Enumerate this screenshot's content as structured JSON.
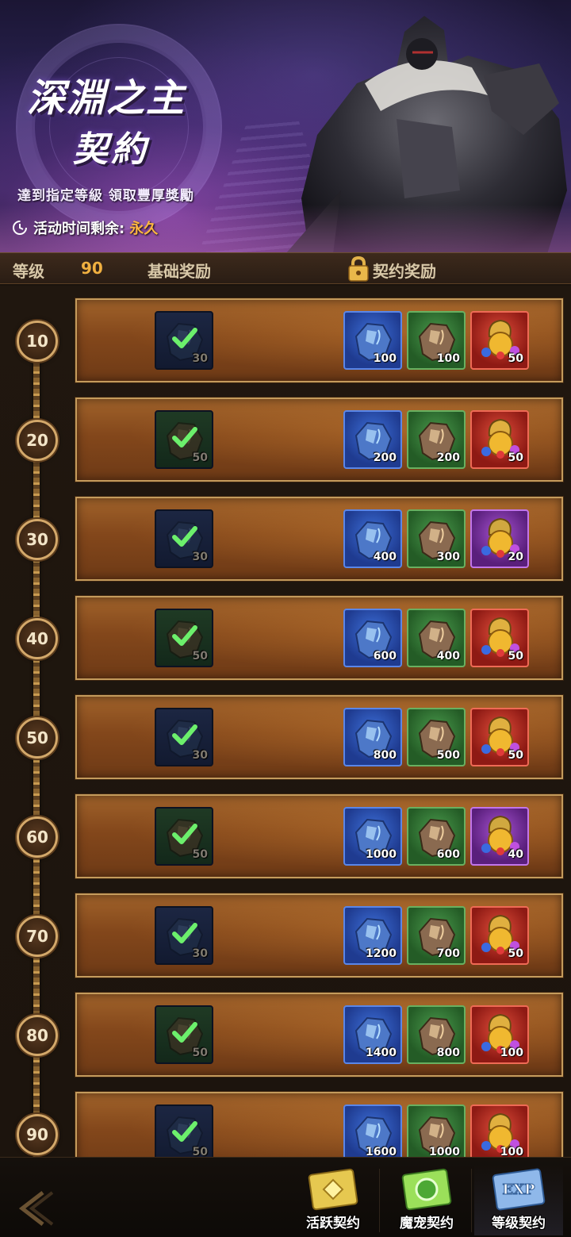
{
  "banner": {
    "title_line1": "深淵之主",
    "title_line2": "契約",
    "tagline": "達到指定等級 領取豐厚獎勵",
    "timer_label": "活动时间剩余:",
    "timer_value": "永久"
  },
  "header": {
    "level_label": "等级",
    "level_value": "90",
    "basic_label": "基础奖励",
    "contract_label": "契约奖励"
  },
  "rows": [
    {
      "level": "10",
      "basic": {
        "type": "blue-ore",
        "qty": "30",
        "claimed": true
      },
      "rewards": [
        {
          "type": "blue-ore",
          "qty": "100"
        },
        {
          "type": "green-ore",
          "qty": "100"
        },
        {
          "type": "red-chest",
          "qty": "50"
        }
      ]
    },
    {
      "level": "20",
      "basic": {
        "type": "green-ore",
        "qty": "50",
        "claimed": true
      },
      "rewards": [
        {
          "type": "blue-ore",
          "qty": "200"
        },
        {
          "type": "green-ore",
          "qty": "200"
        },
        {
          "type": "red-chest",
          "qty": "50"
        }
      ]
    },
    {
      "level": "30",
      "basic": {
        "type": "blue-ore",
        "qty": "30",
        "claimed": true
      },
      "rewards": [
        {
          "type": "blue-ore",
          "qty": "400"
        },
        {
          "type": "green-ore",
          "qty": "300"
        },
        {
          "type": "purple-chest",
          "qty": "20"
        }
      ]
    },
    {
      "level": "40",
      "basic": {
        "type": "green-ore",
        "qty": "50",
        "claimed": true
      },
      "rewards": [
        {
          "type": "blue-ore",
          "qty": "600"
        },
        {
          "type": "green-ore",
          "qty": "400"
        },
        {
          "type": "red-chest",
          "qty": "50"
        }
      ]
    },
    {
      "level": "50",
      "basic": {
        "type": "blue-ore",
        "qty": "30",
        "claimed": true
      },
      "rewards": [
        {
          "type": "blue-ore",
          "qty": "800"
        },
        {
          "type": "green-ore",
          "qty": "500"
        },
        {
          "type": "red-chest",
          "qty": "50"
        }
      ]
    },
    {
      "level": "60",
      "basic": {
        "type": "green-ore",
        "qty": "50",
        "claimed": true
      },
      "rewards": [
        {
          "type": "blue-ore",
          "qty": "1000"
        },
        {
          "type": "green-ore",
          "qty": "600"
        },
        {
          "type": "purple-chest",
          "qty": "40"
        }
      ]
    },
    {
      "level": "70",
      "basic": {
        "type": "blue-ore",
        "qty": "30",
        "claimed": true
      },
      "rewards": [
        {
          "type": "blue-ore",
          "qty": "1200"
        },
        {
          "type": "green-ore",
          "qty": "700"
        },
        {
          "type": "red-chest",
          "qty": "50"
        }
      ]
    },
    {
      "level": "80",
      "basic": {
        "type": "green-ore",
        "qty": "50",
        "claimed": true
      },
      "rewards": [
        {
          "type": "blue-ore",
          "qty": "1400"
        },
        {
          "type": "green-ore",
          "qty": "800"
        },
        {
          "type": "red-chest",
          "qty": "100"
        }
      ]
    },
    {
      "level": "90",
      "basic": {
        "type": "blue-ore",
        "qty": "50",
        "claimed": true
      },
      "rewards": [
        {
          "type": "blue-ore",
          "qty": "1600"
        },
        {
          "type": "green-ore",
          "qty": "1000"
        },
        {
          "type": "red-chest",
          "qty": "100"
        }
      ]
    }
  ],
  "bottom": {
    "tabs": [
      {
        "label": "活跃契约",
        "icon": "gold-scroll-icon"
      },
      {
        "label": "魔宠契约",
        "icon": "green-scroll-icon"
      },
      {
        "label": "等级契约",
        "icon": "exp-scroll-icon",
        "active": true
      }
    ]
  },
  "colors": {
    "accent_gold": "#f0b040",
    "timer_orange": "#ffb640",
    "check_green": "#6cf06c",
    "row_border": "#c49b5c"
  }
}
